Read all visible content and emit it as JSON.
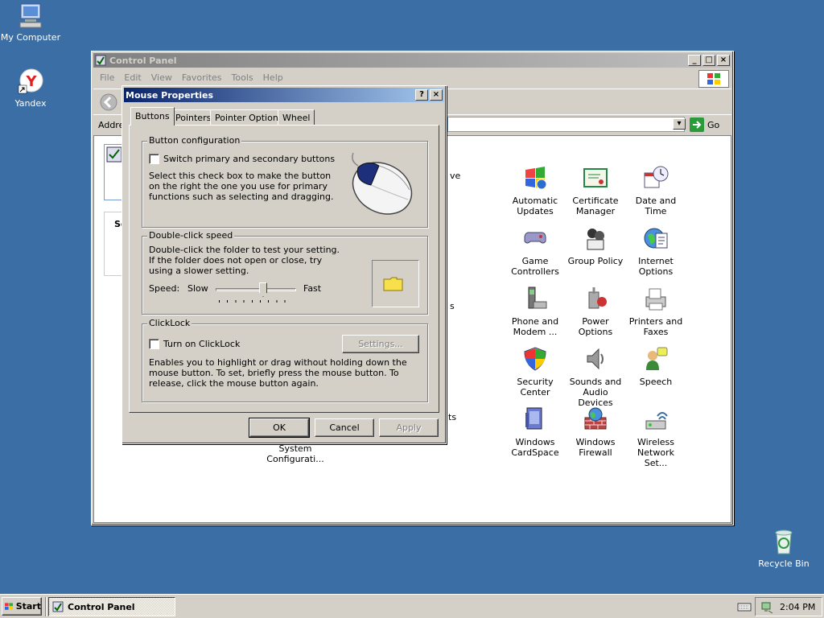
{
  "desktop": {
    "icons": [
      {
        "label": "My Computer",
        "icon": "my-computer-icon"
      },
      {
        "label": "Yandex",
        "icon": "yandex-icon"
      },
      {
        "label": "Recycle Bin",
        "icon": "recycle-bin-icon"
      }
    ]
  },
  "control_panel": {
    "title": "Control Panel",
    "menu": [
      "File",
      "Edit",
      "View",
      "Favorites",
      "Tools",
      "Help"
    ],
    "address_label": "Addre",
    "go_label": "Go",
    "partial_labels": [
      "ve",
      "s",
      "ts"
    ],
    "sidebar_partial": "Se",
    "items": [
      {
        "label": "Automatic Updates",
        "icon": "automatic-updates-icon"
      },
      {
        "label": "Certificate Manager",
        "icon": "certificate-manager-icon"
      },
      {
        "label": "Date and Time",
        "icon": "date-time-icon"
      },
      {
        "label": "Game Controllers",
        "icon": "game-controllers-icon"
      },
      {
        "label": "Group Policy",
        "icon": "group-policy-icon"
      },
      {
        "label": "Internet Options",
        "icon": "internet-options-icon"
      },
      {
        "label": "Phone and Modem ...",
        "icon": "phone-modem-icon"
      },
      {
        "label": "Power Options",
        "icon": "power-options-icon"
      },
      {
        "label": "Printers and Faxes",
        "icon": "printers-faxes-icon"
      },
      {
        "label": "Security Center",
        "icon": "security-center-icon"
      },
      {
        "label": "Sounds and Audio Devices",
        "icon": "sounds-icon"
      },
      {
        "label": "Speech",
        "icon": "speech-icon"
      },
      {
        "label": "Windows CardSpace",
        "icon": "cardspace-icon"
      },
      {
        "label": "Windows Firewall",
        "icon": "firewall-icon"
      },
      {
        "label": "Wireless Network Set...",
        "icon": "wireless-icon"
      }
    ],
    "system_config_label": "System Configurati..."
  },
  "mouse_dialog": {
    "title": "Mouse Properties",
    "help_btn": "?",
    "close_btn": "×",
    "tabs": [
      "Buttons",
      "Pointers",
      "Pointer Options",
      "Wheel"
    ],
    "button_config": {
      "group_label": "Button configuration",
      "checkbox_label": "Switch primary and secondary buttons",
      "checked": false,
      "description": "Select this check box to make the button on the right the one you use for primary functions such as selecting and dragging."
    },
    "double_click": {
      "group_label": "Double-click speed",
      "description": "Double-click the folder to test your setting. If the folder does not open or close, try using a slower setting.",
      "speed_label": "Speed:",
      "slow_label": "Slow",
      "fast_label": "Fast",
      "speed_value_fraction": 0.6
    },
    "clicklock": {
      "group_label": "ClickLock",
      "checkbox_label": "Turn on ClickLock",
      "checked": false,
      "settings_btn": "Settings...",
      "description": "Enables you to highlight or drag without holding down the mouse button. To set, briefly press the mouse button. To release, click the mouse button again."
    },
    "ok": "OK",
    "cancel": "Cancel",
    "apply": "Apply"
  },
  "taskbar": {
    "start_label": "Start",
    "task_label": "Control Panel",
    "clock": "2:04 PM"
  }
}
